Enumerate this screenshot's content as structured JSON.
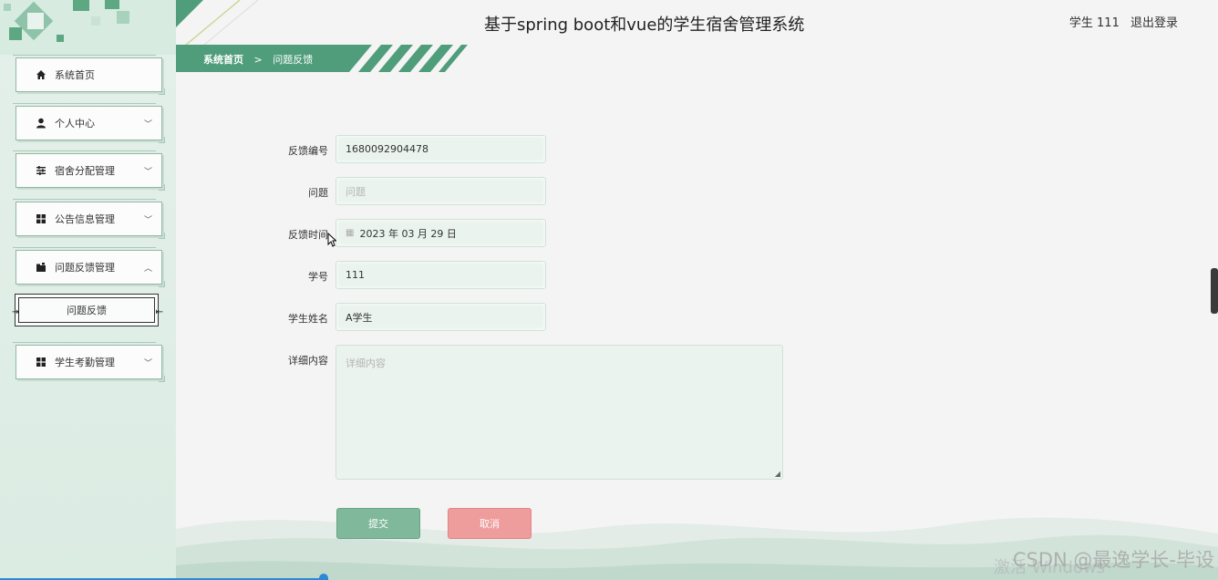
{
  "header": {
    "title": "基于spring boot和vue的学生宿舍管理系统",
    "user": "学生 111",
    "logout": "退出登录"
  },
  "breadcrumb": {
    "home": "系统首页",
    "separator": ">",
    "current": "问题反馈"
  },
  "sidebar": {
    "items": [
      {
        "label": "系统首页",
        "icon": "home-icon"
      },
      {
        "label": "个人中心",
        "icon": "user-icon"
      },
      {
        "label": "宿舍分配管理",
        "icon": "sliders-icon"
      },
      {
        "label": "公告信息管理",
        "icon": "grid-icon"
      },
      {
        "label": "问题反馈管理",
        "icon": "folder-icon"
      },
      {
        "label": "学生考勤管理",
        "icon": "grid-icon"
      }
    ],
    "sub_item": "问题反馈"
  },
  "form": {
    "feedback_no_label": "反馈编号",
    "feedback_no_value": "1680092904478",
    "question_label": "问题",
    "question_placeholder": "问题",
    "time_label": "反馈时间",
    "time_value": "2023 年 03 月 29 日",
    "student_no_label": "学号",
    "student_no_value": "111",
    "student_name_label": "学生姓名",
    "student_name_value": "A学生",
    "detail_label": "详细内容",
    "detail_placeholder": "详细内容",
    "submit": "提交",
    "cancel": "取消"
  },
  "watermark": "CSDN @最逸学长-毕设",
  "windows_mark": "激活 Windows",
  "colors": {
    "accent": "#4f9d7b",
    "submit": "#7fb89a",
    "cancel": "#ee9c9c",
    "sidebar_bg": "#dbece3"
  }
}
